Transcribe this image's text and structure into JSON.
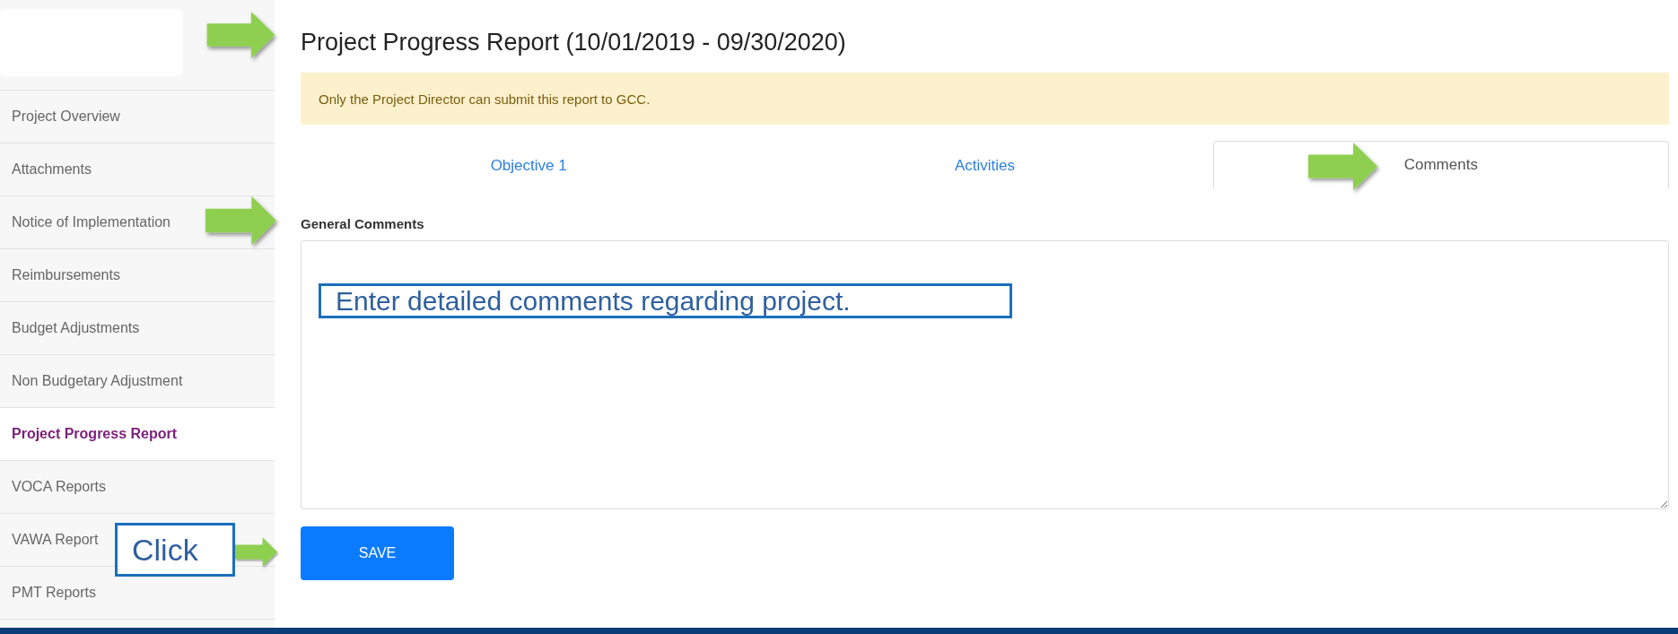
{
  "sidebar": {
    "items": [
      {
        "label": "Project Overview",
        "selected": false
      },
      {
        "label": "Attachments",
        "selected": false
      },
      {
        "label": "Notice of Implementation",
        "selected": false
      },
      {
        "label": "Reimbursements",
        "selected": false
      },
      {
        "label": "Budget Adjustments",
        "selected": false
      },
      {
        "label": "Non Budgetary Adjustment",
        "selected": false
      },
      {
        "label": "Project Progress Report",
        "selected": true
      },
      {
        "label": "VOCA Reports",
        "selected": false
      },
      {
        "label": "VAWA Report",
        "selected": false
      },
      {
        "label": "PMT Reports",
        "selected": false
      }
    ]
  },
  "page": {
    "title": "Project Progress Report (10/01/2019 - 09/30/2020)",
    "alert": "Only the Project Director can submit this report to GCC."
  },
  "tabs": [
    {
      "label": "Objective 1",
      "selected": false
    },
    {
      "label": "Activities",
      "selected": false
    },
    {
      "label": "Comments",
      "selected": true
    }
  ],
  "form": {
    "label": "General Comments",
    "button": "SAVE"
  },
  "callouts": [
    {
      "kind": "field",
      "text": "Enter detailed comments regarding project."
    },
    {
      "kind": "button",
      "text": "Click"
    }
  ]
}
